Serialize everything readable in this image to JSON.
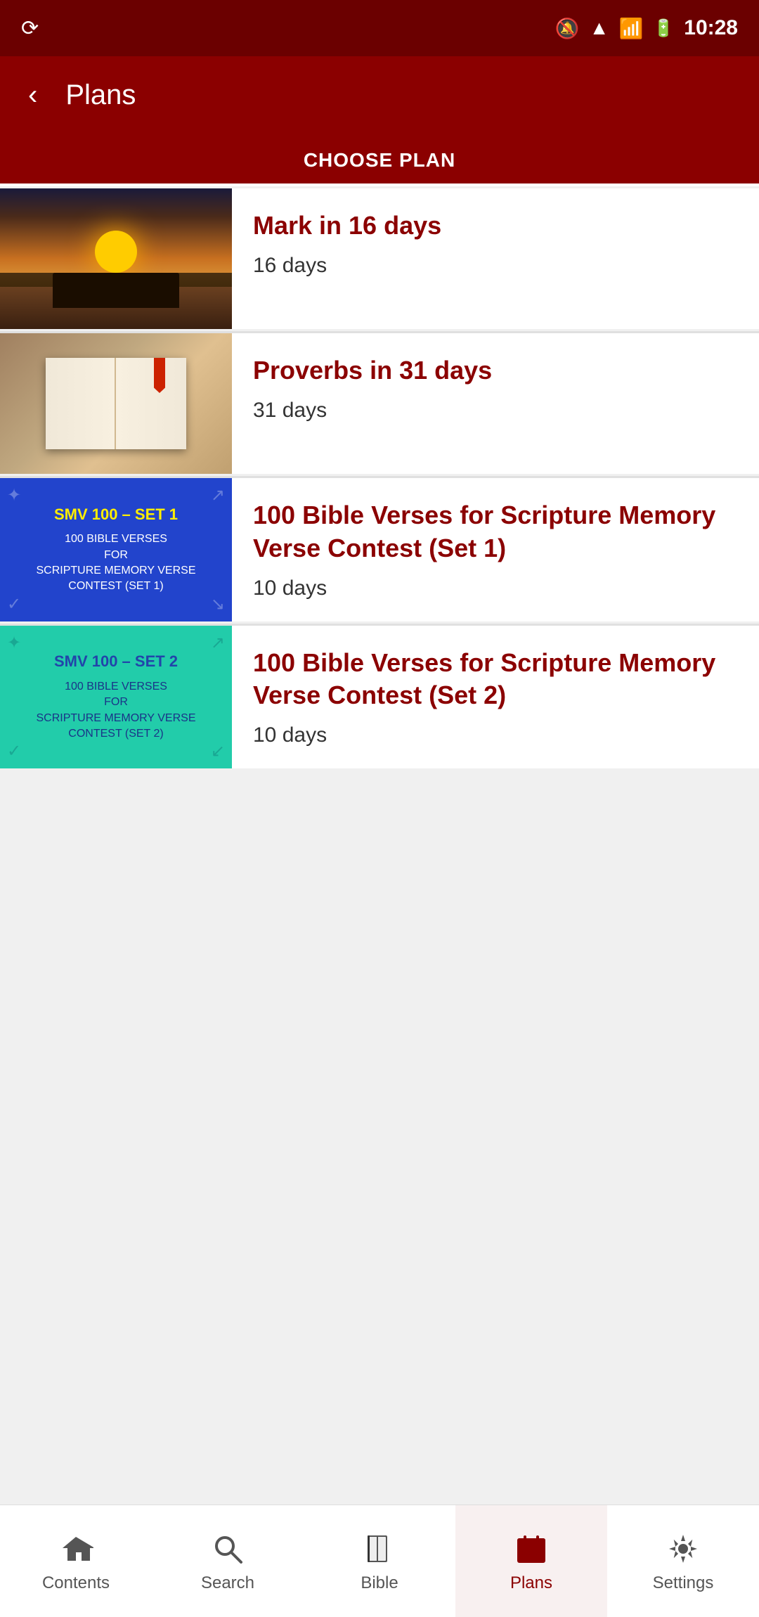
{
  "statusBar": {
    "time": "10:28",
    "icons": [
      "notification-muted",
      "wifi",
      "signal",
      "battery"
    ]
  },
  "topBar": {
    "title": "Plans",
    "backLabel": "←"
  },
  "tabs": [
    {
      "id": "choose-plan",
      "label": "CHOOSE PLAN",
      "active": true
    }
  ],
  "plans": [
    {
      "id": "mark-16",
      "title": "Mark in 16 days",
      "days": "16 days",
      "thumbType": "sunset"
    },
    {
      "id": "proverbs-31",
      "title": "Proverbs in 31 days",
      "days": "31 days",
      "thumbType": "bible"
    },
    {
      "id": "smv-set1",
      "title": "100 Bible Verses for Scripture Memory Verse Contest (Set 1)",
      "days": "10 days",
      "thumbType": "smv1",
      "thumbLine1": "SMV 100 – SET 1",
      "thumbLine2": "100 BIBLE VERSES",
      "thumbLine3": "FOR",
      "thumbLine4": "SCRIPTURE MEMORY VERSE",
      "thumbLine5": "CONTEST (SET 1)"
    },
    {
      "id": "smv-set2",
      "title": "100 Bible Verses for Scripture Memory Verse Contest (Set 2)",
      "days": "10 days",
      "thumbType": "smv2",
      "thumbLine1": "SMV 100 – SET 2",
      "thumbLine2": "100 BIBLE VERSES",
      "thumbLine3": "FOR",
      "thumbLine4": "SCRIPTURE MEMORY VERSE",
      "thumbLine5": "CONTEST (SET 2)"
    }
  ],
  "bottomNav": [
    {
      "id": "contents",
      "label": "Contents",
      "icon": "home",
      "active": false
    },
    {
      "id": "search",
      "label": "Search",
      "icon": "search",
      "active": false
    },
    {
      "id": "bible",
      "label": "Bible",
      "icon": "book",
      "active": false
    },
    {
      "id": "plans",
      "label": "Plans",
      "icon": "calendar",
      "active": true
    },
    {
      "id": "settings",
      "label": "Settings",
      "icon": "gear",
      "active": false
    }
  ]
}
